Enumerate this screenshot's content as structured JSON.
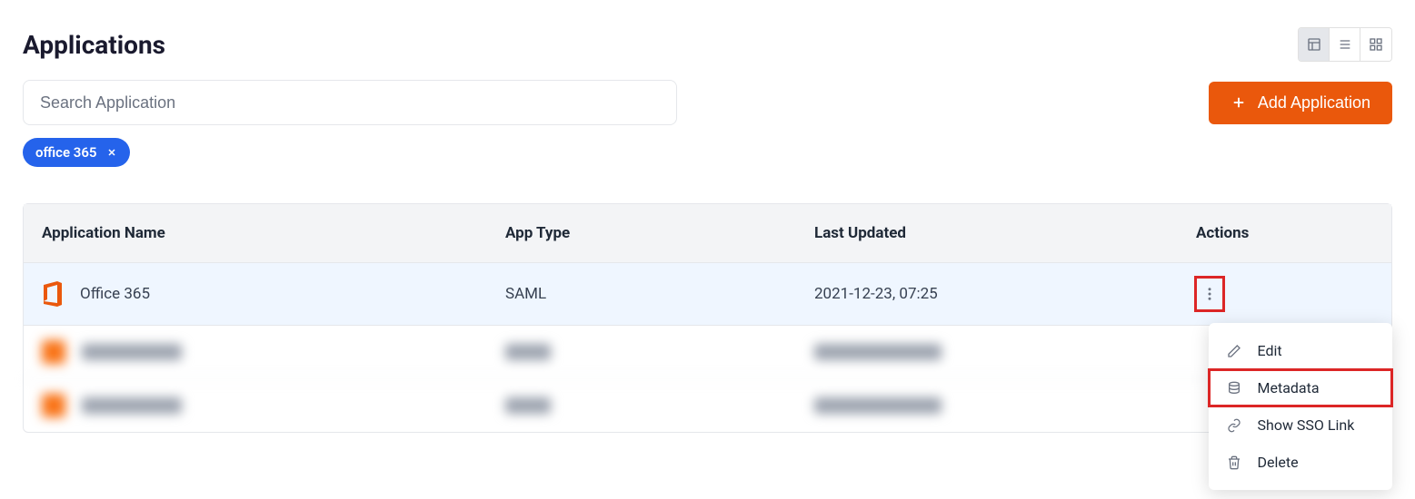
{
  "page": {
    "title": "Applications"
  },
  "search": {
    "placeholder": "Search Application"
  },
  "add_button": {
    "label": "Add Application"
  },
  "filter_chip": {
    "label": "office 365"
  },
  "columns": {
    "name": "Application Name",
    "type": "App Type",
    "updated": "Last Updated",
    "actions": "Actions"
  },
  "rows": [
    {
      "name": "Office 365",
      "type": "SAML",
      "updated": "2021-12-23, 07:25"
    }
  ],
  "menu": {
    "edit": "Edit",
    "metadata": "Metadata",
    "show_sso": "Show SSO Link",
    "delete": "Delete"
  }
}
